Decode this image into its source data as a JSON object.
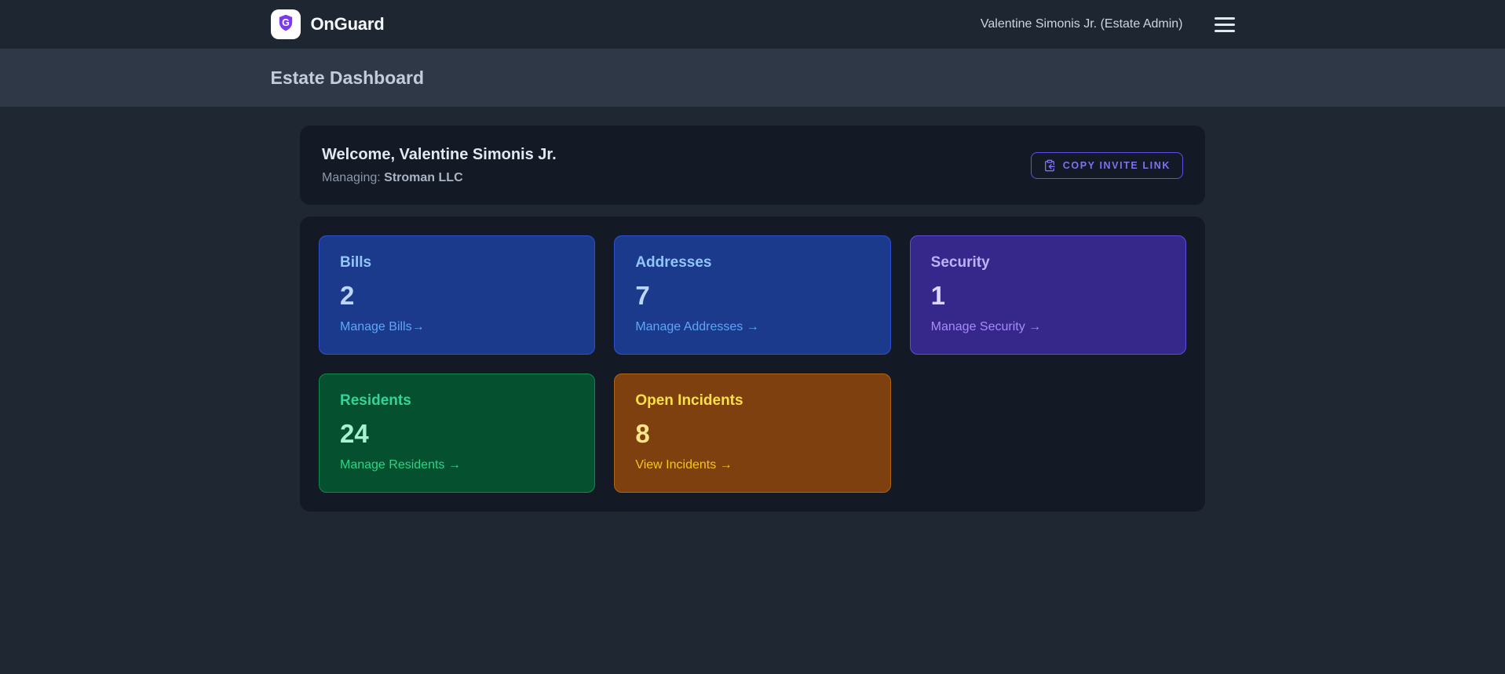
{
  "nav": {
    "brand": "OnGuard",
    "logo_icon": "shield-g-icon",
    "user": "Valentine Simonis Jr. (Estate Admin)",
    "menu_icon": "hamburger-menu-icon"
  },
  "header": {
    "title": "Estate Dashboard"
  },
  "welcome": {
    "greeting": "Welcome, Valentine Simonis Jr.",
    "managing_label": "Managing:",
    "managing_value": "Stroman LLC",
    "copy_button_label": "COPY INVITE LINK",
    "copy_button_icon": "clipboard-copy-icon"
  },
  "stats": {
    "cards": [
      {
        "title": "Bills",
        "value": "2",
        "link": "Manage Bills→",
        "theme": "blue"
      },
      {
        "title": "Addresses",
        "value": "7",
        "link": "Manage Addresses →",
        "theme": "blue"
      },
      {
        "title": "Security",
        "value": "1",
        "link": "Manage Security →",
        "theme": "violet"
      },
      {
        "title": "Residents",
        "value": "24",
        "link": "Manage Residents →",
        "theme": "green"
      },
      {
        "title": "Open Incidents",
        "value": "8",
        "link": "View Incidents →",
        "theme": "amber"
      }
    ]
  },
  "colors": {
    "navbar_bg": "#1e2631",
    "header_bar_bg": "#2f3847",
    "page_bg": "#1f2732",
    "panel_bg": "#131a26",
    "accent_purple": "#7c3aed",
    "button_border": "#5f51e8",
    "button_text": "#7e71f2",
    "card_blue_bg": "#1c3a8c",
    "card_violet_bg": "#36288b",
    "card_green_bg": "#05502f",
    "card_amber_bg": "#7f400f"
  }
}
